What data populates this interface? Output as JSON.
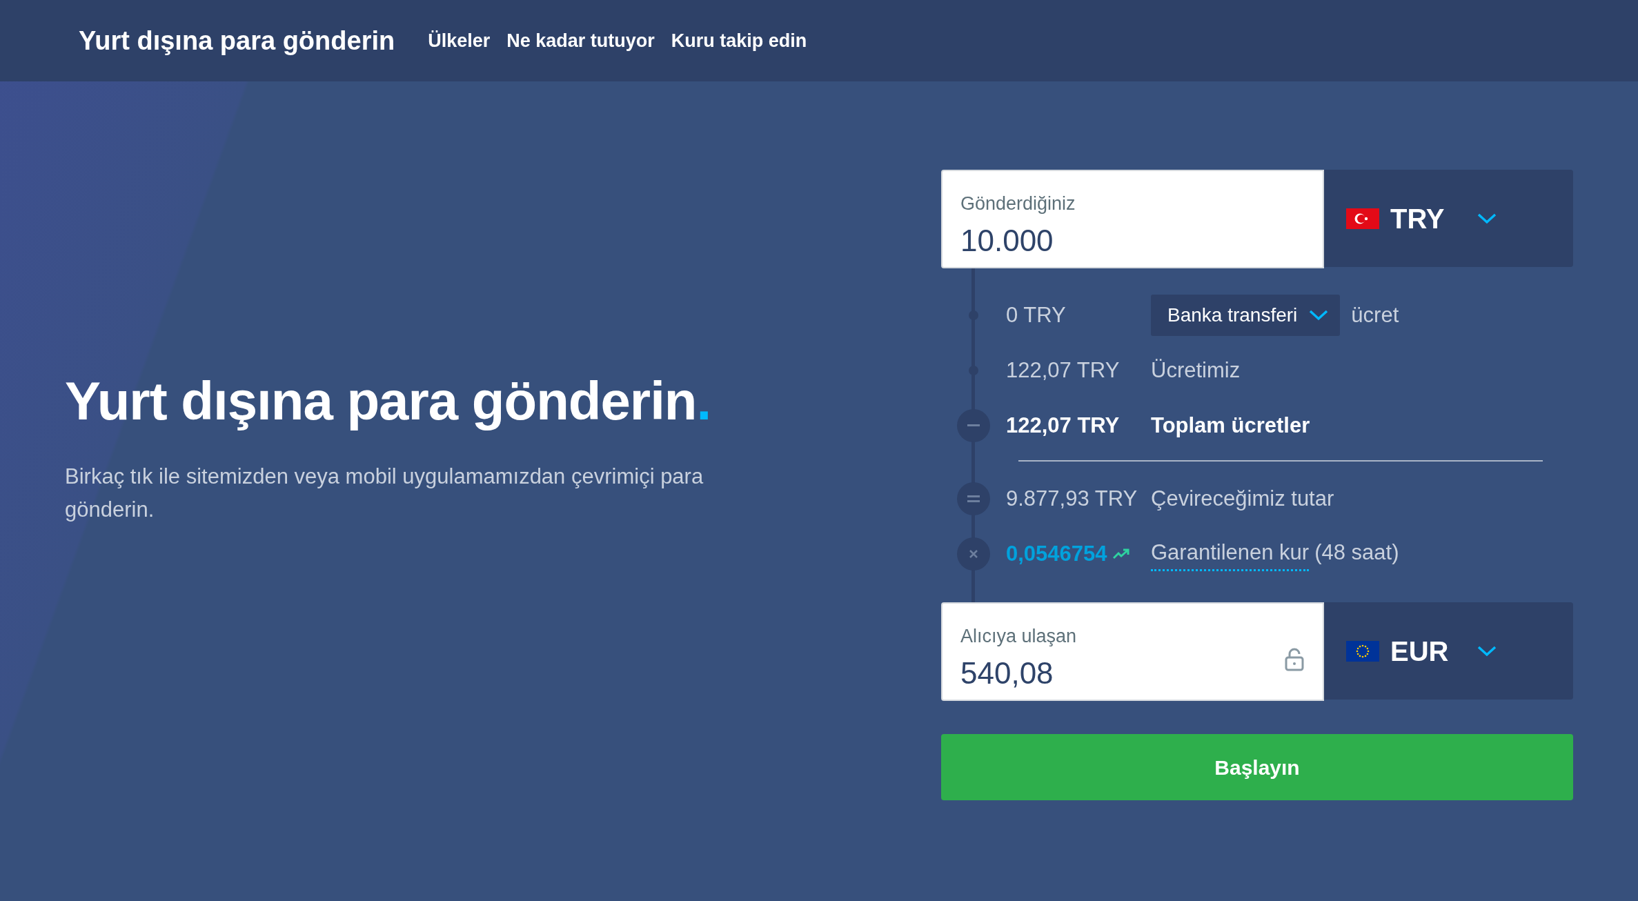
{
  "nav": {
    "brand": "Yurt dışına para gönderin",
    "links": [
      "Ülkeler",
      "Ne kadar tutuyor",
      "Kuru takip edin"
    ]
  },
  "hero": {
    "title": "Yurt dışına para gönderin.",
    "subtitle": "Birkaç tık ile sitemizden veya mobil uygulamamızdan çevrimiçi para gönderin."
  },
  "calculator": {
    "send": {
      "label": "Gönderdiğiniz",
      "value": "10.000",
      "currency": "TRY",
      "kind": "turkey"
    },
    "steps": [
      {
        "kind": "method",
        "amount": "0 TRY",
        "method": "Banka transferi",
        "label": "ücret"
      },
      {
        "kind": "fee",
        "amount": "122,07 TRY",
        "label": "Ücretimiz"
      },
      {
        "kind": "total",
        "amount": "122,07 TRY",
        "label": "Toplam ücretler"
      },
      {
        "kind": "converted",
        "amount": "9.877,93 TRY",
        "label": "Çevireceğimiz tutar"
      },
      {
        "kind": "rate",
        "amount": "0,0546754",
        "label": "Garantilenen kur",
        "note": "(48 saat)"
      }
    ],
    "receive": {
      "label": "Alıcıya ulaşan",
      "value": "540,08",
      "currency": "EUR",
      "kind": "europe",
      "locked": false
    },
    "button": "Başlayın"
  }
}
